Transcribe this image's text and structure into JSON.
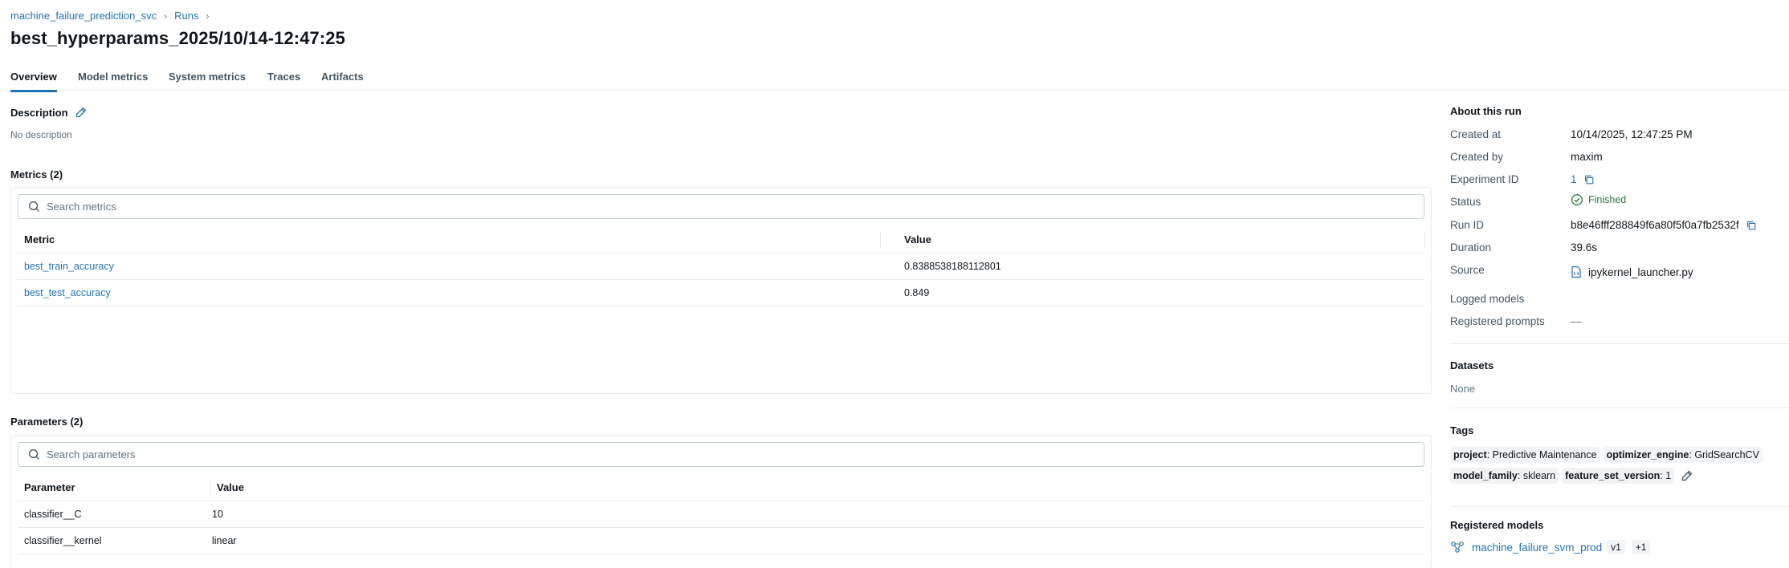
{
  "breadcrumb": {
    "experiment": "machine_failure_prediction_svc",
    "runs": "Runs"
  },
  "run_title": "best_hyperparams_2025/10/14-12:47:25",
  "tabs": [
    {
      "label": "Overview",
      "active": true
    },
    {
      "label": "Model metrics",
      "active": false
    },
    {
      "label": "System metrics",
      "active": false
    },
    {
      "label": "Traces",
      "active": false
    },
    {
      "label": "Artifacts",
      "active": false
    }
  ],
  "description": {
    "title": "Description",
    "text": "No description"
  },
  "metrics": {
    "title": "Metrics (2)",
    "search_placeholder": "Search metrics",
    "columns": [
      "Metric",
      "Value"
    ],
    "rows": [
      {
        "name": "best_train_accuracy",
        "value": "0.8388538188112801"
      },
      {
        "name": "best_test_accuracy",
        "value": "0.849"
      }
    ]
  },
  "parameters": {
    "title": "Parameters (2)",
    "search_placeholder": "Search parameters",
    "columns": [
      "Parameter",
      "Value"
    ],
    "rows": [
      {
        "name": "classifier__C",
        "value": "10"
      },
      {
        "name": "classifier__kernel",
        "value": "linear"
      }
    ]
  },
  "about": {
    "title": "About this run",
    "created_at_label": "Created at",
    "created_at": "10/14/2025, 12:47:25 PM",
    "created_by_label": "Created by",
    "created_by": "maxim",
    "experiment_id_label": "Experiment ID",
    "experiment_id": "1",
    "status_label": "Status",
    "status": "Finished",
    "run_id_label": "Run ID",
    "run_id": "b8e46fff288849f6a80f5f0a7fb2532f",
    "duration_label": "Duration",
    "duration": "39.6s",
    "source_label": "Source",
    "source": "ipykernel_launcher.py",
    "logged_models_label": "Logged models",
    "registered_prompts_label": "Registered prompts",
    "registered_prompts": "—"
  },
  "datasets": {
    "title": "Datasets",
    "value": "None"
  },
  "tags": {
    "title": "Tags",
    "items": [
      {
        "key": "project",
        "value": ": Predictive Maintenance"
      },
      {
        "key": "optimizer_engine",
        "value": ": GridSearchCV"
      },
      {
        "key": "model_family",
        "value": ": sklearn"
      },
      {
        "key": "feature_set_version",
        "value": ": 1"
      }
    ]
  },
  "registered_models": {
    "title": "Registered models",
    "model": "machine_failure_svm_prod",
    "version": "v1",
    "more": "+1"
  },
  "colors": {
    "link": "#2272b4",
    "status_success": "#277c43",
    "border": "#e8ecf0",
    "text": "#11171c"
  }
}
